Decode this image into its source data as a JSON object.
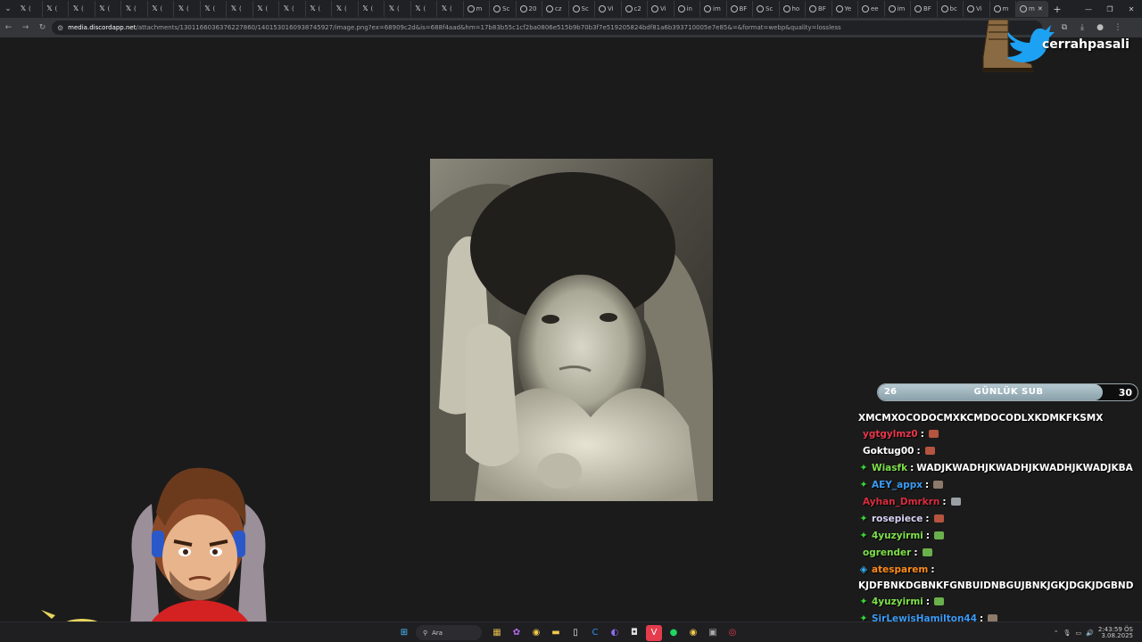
{
  "browser": {
    "tabs": [
      {
        "label": "(",
        "icon": "x-icon"
      },
      {
        "label": "(",
        "icon": "x-icon"
      },
      {
        "label": "(",
        "icon": "x-icon"
      },
      {
        "label": "(",
        "icon": "x-icon"
      },
      {
        "label": "(",
        "icon": "x-icon"
      },
      {
        "label": "(",
        "icon": "x-icon"
      },
      {
        "label": "(",
        "icon": "x-icon"
      },
      {
        "label": "(",
        "icon": "x-icon"
      },
      {
        "label": "(",
        "icon": "x-icon"
      },
      {
        "label": "(",
        "icon": "x-icon"
      },
      {
        "label": "(",
        "icon": "x-icon"
      },
      {
        "label": "(",
        "icon": "x-icon"
      },
      {
        "label": "(",
        "icon": "x-icon"
      },
      {
        "label": "(",
        "icon": "x-icon"
      },
      {
        "label": "(",
        "icon": "x-icon"
      },
      {
        "label": "(",
        "icon": "x-icon"
      },
      {
        "label": "(",
        "icon": "x-icon"
      },
      {
        "label": "m",
        "icon": "globe-icon"
      },
      {
        "label": "Sc",
        "icon": "globe-icon"
      },
      {
        "label": "20",
        "icon": "globe-icon"
      },
      {
        "label": "cz",
        "icon": "globe-icon"
      },
      {
        "label": "Sc",
        "icon": "globe-icon"
      },
      {
        "label": "Vi",
        "icon": "globe-icon"
      },
      {
        "label": "c2",
        "icon": "globe-icon"
      },
      {
        "label": "Vi",
        "icon": "globe-icon"
      },
      {
        "label": "in",
        "icon": "globe-icon"
      },
      {
        "label": "im",
        "icon": "globe-icon"
      },
      {
        "label": "BF",
        "icon": "globe-icon"
      },
      {
        "label": "Sc",
        "icon": "globe-icon"
      },
      {
        "label": "ho",
        "icon": "globe-icon"
      },
      {
        "label": "BF",
        "icon": "globe-icon"
      },
      {
        "label": "Ye",
        "icon": "globe-icon"
      },
      {
        "label": "ee",
        "icon": "globe-icon"
      },
      {
        "label": "im",
        "icon": "globe-icon"
      },
      {
        "label": "BF",
        "icon": "globe-icon"
      },
      {
        "label": "bc",
        "icon": "globe-icon"
      },
      {
        "label": "Vi",
        "icon": "globe-icon"
      },
      {
        "label": "m",
        "icon": "globe-icon"
      }
    ],
    "active_tab": {
      "label": "m",
      "icon": "globe-icon"
    },
    "url_host": "media.discordapp.net",
    "url_rest": "/attachments/1301166036376227860/1401530160938745927/image.png?ex=68909c2d&is=688f4aad&hm=17b83b55c1cf2ba0806e515b9b70b3f7e519205824bdf81a6b393710005e7e85&=&format=webp&quality=lossless"
  },
  "overlay": {
    "twitter_name": "cerrahpasali",
    "sub_bar": {
      "current": "26",
      "label": "GÜNLÜK SUB",
      "goal": "30",
      "progress": 0.867
    }
  },
  "chat": {
    "messages": [
      {
        "user": "",
        "user_color": "#ffffff",
        "badge": "",
        "text": "XMCMXOCODOCMXKCMDOCODLXKDMKFKSMX",
        "emote_color": ""
      },
      {
        "user": "ygtgylmz0",
        "user_color": "#e8374a",
        "badge": "",
        "text": "",
        "emote_color": "#b5543f"
      },
      {
        "user": "Goktug00",
        "user_color": "#ffffff",
        "badge": "",
        "text": "",
        "emote_color": "#b5543f"
      },
      {
        "user": "Wiasfk",
        "user_color": "#7ee04a",
        "badge": "✦",
        "text": "WADJKWADHJKWADHJKWADHJKWADJKBA",
        "emote_color": ""
      },
      {
        "user": "AEY_appx",
        "user_color": "#3c9cf5",
        "badge": "✦",
        "text": "",
        "emote_color": "#8c7a6a"
      },
      {
        "user": "Ayhan_Dmrkrn",
        "user_color": "#d92c3e",
        "badge": "",
        "text": "",
        "emote_color": "#9aa0a6"
      },
      {
        "user": "rosepiece",
        "user_color": "#d9d2f5",
        "badge": "✦",
        "text": "",
        "emote_color": "#b5543f"
      },
      {
        "user": "4yuzyirmi",
        "user_color": "#7ee04a",
        "badge": "✦",
        "text": "",
        "emote_color": "#6ab04c"
      },
      {
        "user": "ogrender",
        "user_color": "#7ee04a",
        "badge": "",
        "text": "",
        "emote_color": "#6ab04c"
      },
      {
        "user": "atesparem",
        "user_color": "#ff8c1a",
        "badge": "◈",
        "text": "",
        "emote_color": ""
      },
      {
        "user": "",
        "user_color": "#ffffff",
        "badge": "",
        "text": "KJDFBNKDGBNKFGNBUIDNBGUJBNKJGKJDGKJDGBND",
        "emote_color": ""
      },
      {
        "user": "4yuzyirmi",
        "user_color": "#7ee04a",
        "badge": "✦",
        "text": "",
        "emote_color": "#6ab04c"
      },
      {
        "user": "SirLewisHamilton44",
        "user_color": "#3c9cf5",
        "badge": "✦",
        "text": "",
        "emote_color": "#8c7a6a"
      }
    ]
  },
  "taskbar": {
    "search_placeholder": "Ara",
    "time": "2:43:59 ÖS",
    "date": "3.08.2025"
  }
}
